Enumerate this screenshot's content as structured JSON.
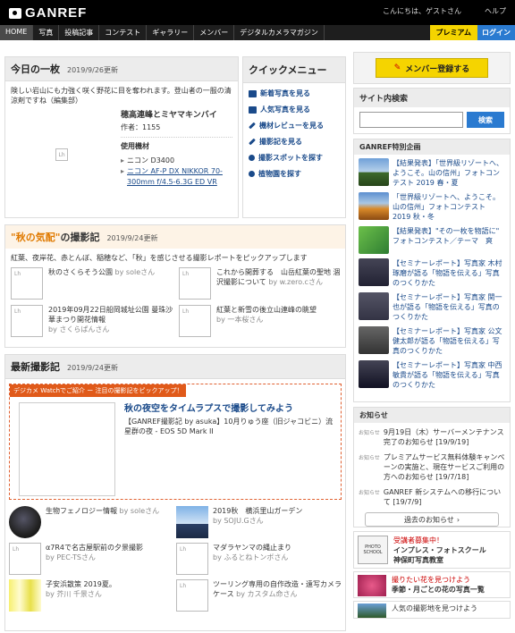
{
  "header": {
    "logo": "GANREF",
    "greeting": "こんにちは、ゲストさん",
    "help": "ヘルプ"
  },
  "nav": {
    "items": [
      "HOME",
      "写真",
      "投稿記事",
      "コンテスト",
      "ギャラリー",
      "メンバー",
      "デジタルカメラマガジン"
    ],
    "premium": "プレミアム",
    "login": "ログイン"
  },
  "today": {
    "title": "今日の一枚",
    "date": "2019/9/26更新",
    "comment": "険しい岩山にも力強く咲く野花に目を奪われます。登山者の一服の清涼剤ですね（編集部）",
    "photo_title": "穂高連峰とミヤマキンバイ",
    "author": "作者：1155",
    "equip_label": "使用機材",
    "camera": "ニコン D3400",
    "lens": "ニコン AF-P DX NIKKOR 70-300mm f/4.5-6.3G ED VR"
  },
  "quick": {
    "title": "クイックメニュー",
    "items": [
      "新着写真を見る",
      "人気写真を見る",
      "機材レビューを見る",
      "撮影記を見る",
      "撮影スポットを探す",
      "植物園を探す"
    ]
  },
  "autumn": {
    "title_accent": "\"秋の気配\"",
    "title_rest": "の撮影記",
    "date": "2019/9/24更新",
    "desc": "紅葉、夜岸花、赤とんぼ、稲穂など、「秋」を感じさせる撮影レポートをピックアップします",
    "items": [
      {
        "title": "秋のさくらそう公園",
        "by": "by soleさん"
      },
      {
        "title": "これから開葬する　山岳紅葉の聖地 涸沢撮影について",
        "by": "by w.zero.cさん"
      },
      {
        "title": "2019年09月22日船岡城址公園 曼珠沙華まつり開花情報",
        "by": "by さくらぱんさん"
      },
      {
        "title": "紅葉と新雪の後立山連峰の眺望",
        "by": "by 一本桜さん"
      }
    ]
  },
  "latest": {
    "title": "最新撮影記",
    "date": "2019/9/24更新",
    "pick_bar": "デジカメ Watchでご紹介 ー 注目の撮影記をピックアップ！",
    "feat_title": "秋の夜空をタイムラプスで撮影してみよう",
    "feat_desc": "【GANREF撮影記 by asuka】10月りゅう座（旧ジャコビニ）流星群の夜 - EOS 5D Mark II",
    "items": [
      {
        "title": "生物フェノロジー情報",
        "by": "by soleさん"
      },
      {
        "title": "2019秋　横浜里山ガーデン",
        "by": "by SOJU.Gさん"
      },
      {
        "title": "α7R4で名古屋駅前の夕景撮影",
        "by": "by PEC-TSさん"
      },
      {
        "title": "マダラヤンマの縄止まり",
        "by": "by ふるとねトンボさん"
      },
      {
        "title": "子安浜散策 2019夏。",
        "by": "by 芥川 千景さん"
      },
      {
        "title": "ツーリング専用の自作改造・遠写カメラケース",
        "by": "by カスタム命さん"
      }
    ]
  },
  "right": {
    "member_btn": "メンバー登録する",
    "search_title": "サイト内検索",
    "search_button": "検索",
    "special_title": "GANREF特別企画",
    "special": [
      "【結果発表】「世界級リゾートへ、ようこそ。山の信州」フォトコンテスト 2019 春・夏",
      "「世界級リゾートへ、ようこそ。山の信州」フォトコンテスト 2019 秋・冬",
      "【結果発表】\"その一枚を物語に\" フォトコンテスト／テーマ　爽",
      "【セミナーレポート】写真家 木村琢磨が語る「物語を伝える」写真のつくりかた",
      "【セミナーレポート】写真家 関一也が語る「物語を伝える」写真のつくりかた",
      "【セミナーレポート】写真家 公文健太郎が語る「物語を伝える」写真のつくりかた",
      "【セミナーレポート】写真家 中西敏貴が語る「物語を伝える」写真のつくりかた"
    ],
    "news_title": "お知らせ",
    "news_label": "お知らせ",
    "news": [
      "9月19日（木）サーバーメンテナンス完了のお知らせ [19/9/19]",
      "プレミアムサービス無料体験キャンペーンの実施と、現在サービスご利用の方へのお知らせ [19/7/18]",
      "GANREF 新システムへの移行について [19/7/9]"
    ],
    "past_news": "過去のお知らせ",
    "promo1_line1": "受講者募集中！",
    "promo1_line2": "インプレス・フォトスクール",
    "promo1_line3": "神保町写真教室",
    "photo_school": "PHOTO SCHOOL",
    "promo2_line1": "撮りたい花を見つけよう",
    "promo2_line2": "季節・月ごとの花の写真一覧",
    "promo3": "人気の撮影地を見つけよう"
  }
}
